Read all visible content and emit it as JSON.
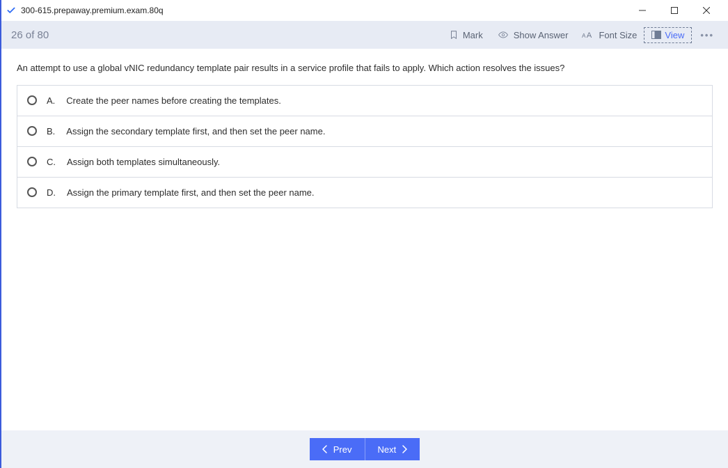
{
  "window": {
    "title": "300-615.prepaway.premium.exam.80q"
  },
  "toolbar": {
    "progress": "26 of 80",
    "mark": "Mark",
    "show_answer": "Show Answer",
    "font_size": "Font Size",
    "view": "View"
  },
  "question": {
    "text": "An attempt to use a global vNIC redundancy template pair results in a service profile that fails to apply. Which action resolves the issues?",
    "options": [
      {
        "letter": "A.",
        "text": "Create the peer names before creating the templates."
      },
      {
        "letter": "B.",
        "text": "Assign the secondary template first, and then set the peer name."
      },
      {
        "letter": "C.",
        "text": "Assign both templates simultaneously."
      },
      {
        "letter": "D.",
        "text": "Assign the primary template first, and then set the peer name."
      }
    ]
  },
  "footer": {
    "prev": "Prev",
    "next": "Next"
  }
}
